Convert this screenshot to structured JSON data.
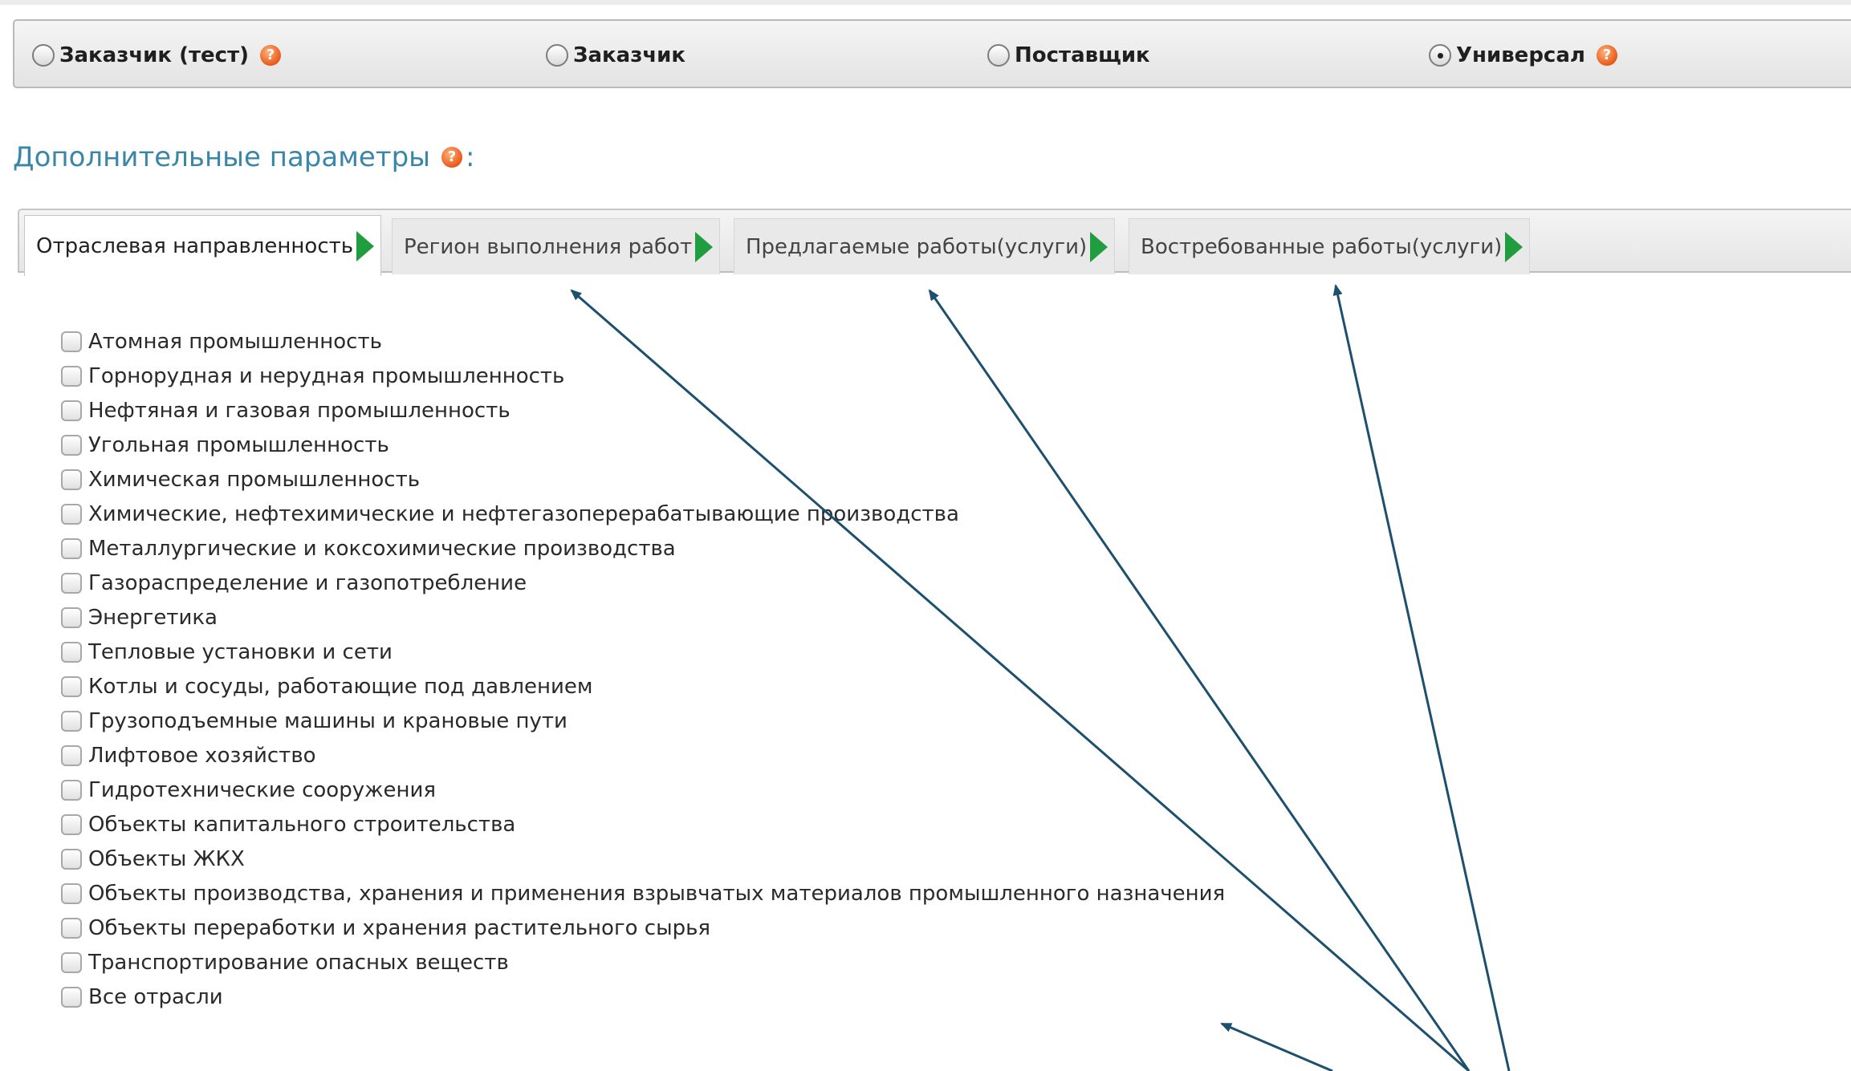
{
  "roles": [
    {
      "label": "Заказчик (тест)",
      "checked": false,
      "help": true
    },
    {
      "label": "Заказчик",
      "checked": false,
      "help": false
    },
    {
      "label": "Поставщик",
      "checked": false,
      "help": false
    },
    {
      "label": "Универсал",
      "checked": true,
      "help": true
    }
  ],
  "help_icon": "?",
  "section": {
    "title": "Дополнительные параметры",
    "suffix": ":"
  },
  "tabs": [
    {
      "label": "Отраслевая направленность",
      "active": true
    },
    {
      "label": "Регион выполнения работ",
      "active": false
    },
    {
      "label": "Предлагаемые работы(услуги)",
      "active": false
    },
    {
      "label": "Востребованные работы(услуги)",
      "active": false
    }
  ],
  "industries": [
    "Атомная промышленность",
    "Горнорудная и нерудная промышленность",
    "Нефтяная и газовая промышленность",
    "Угольная промышленность",
    "Химическая промышленность",
    "Химические, нефтехимические и нефтегазоперерабатывающие производства",
    "Металлургические и коксохимические производства",
    "Газораспределение и газопотребление",
    "Энергетика",
    "Тепловые установки и сети",
    "Котлы и сосуды, работающие под давлением",
    "Грузоподъемные машины и крановые пути",
    "Лифтовое хозяйство",
    "Гидротехнические сооружения",
    "Объекты капитального строительства",
    "Объекты ЖКХ",
    "Объекты производства, хранения и применения взрывчатых материалов промышленного назначения",
    "Объекты переработки и хранения растительного сырья",
    "Транспортирование опасных веществ",
    "Все отрасли"
  ],
  "colors": {
    "accent_title": "#3a86a8",
    "tab_arrow": "#1f9d3f",
    "annotation_arrow": "#1d4f6e",
    "help_icon": "#e8591b"
  }
}
